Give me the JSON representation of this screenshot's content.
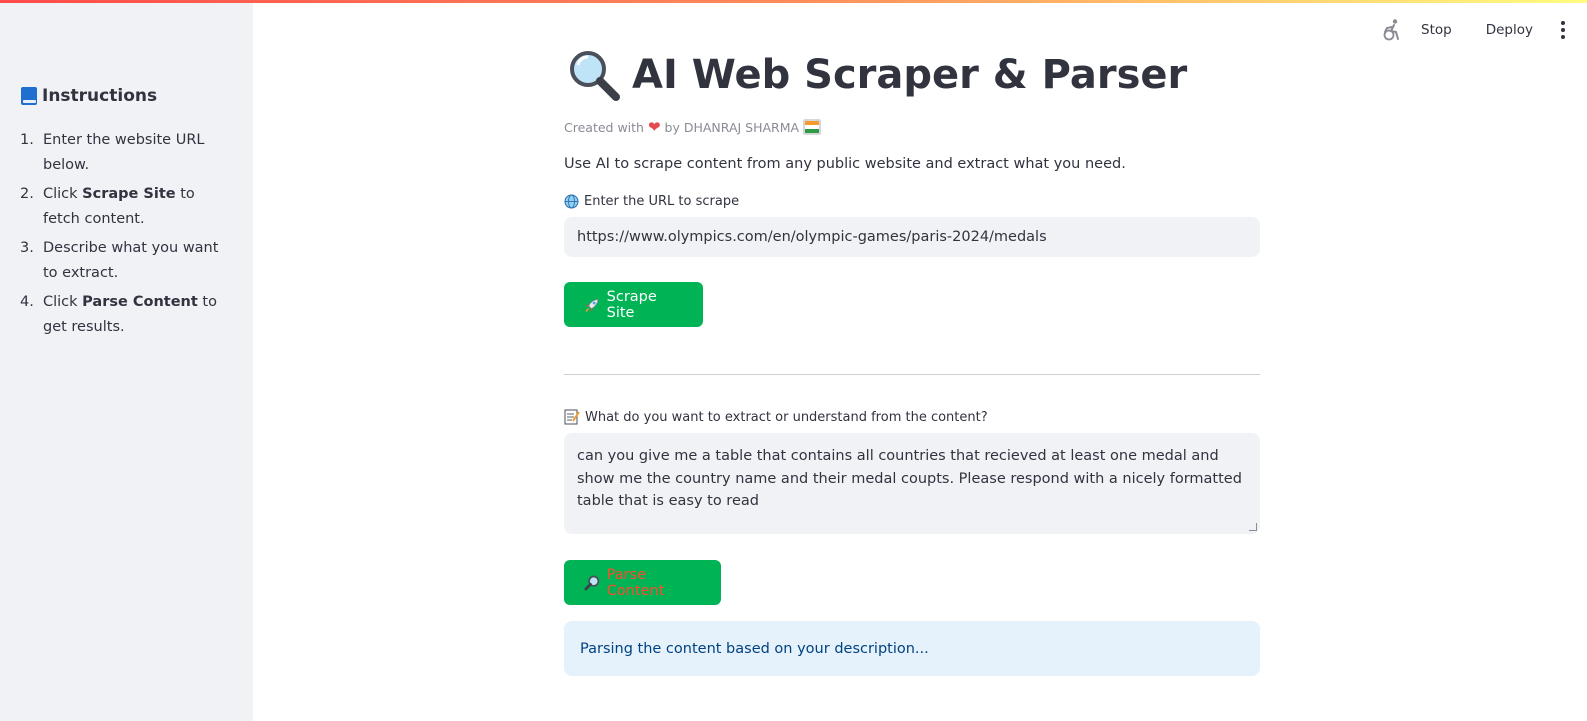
{
  "toolbar": {
    "stop_label": "Stop",
    "deploy_label": "Deploy"
  },
  "sidebar": {
    "header": "Instructions",
    "items": [
      {
        "num": "1.",
        "pre": "Enter the website URL below.",
        "bold": "",
        "post": ""
      },
      {
        "num": "2.",
        "pre": "Click ",
        "bold": "Scrape Site",
        "post": " to fetch content."
      },
      {
        "num": "3.",
        "pre": "Describe what you want to extract.",
        "bold": "",
        "post": ""
      },
      {
        "num": "4.",
        "pre": "Click ",
        "bold": "Parse Content",
        "post": " to get results."
      }
    ]
  },
  "main": {
    "title": "AI Web Scraper & Parser",
    "created_prefix": "Created with",
    "created_suffix": "by DHANRAJ SHARMA",
    "description": "Use AI to scrape content from any public website and extract what you need.",
    "url_label": "Enter the URL to scrape",
    "url_value": "https://www.olympics.com/en/olympic-games/paris-2024/medals",
    "scrape_button": "Scrape Site",
    "extract_label": "What do you want to extract or understand from the content?",
    "extract_value": "can you give me a table that contains all countries that recieved at least one medal and show me the country name and their medal coupts. Please respond with a nicely formatted table that is easy to read",
    "parse_button": "Parse Content",
    "info_text": "Parsing the content based on your description..."
  },
  "colors": {
    "accent_green": "#00b355",
    "sidebar_bg": "#f0f2f6",
    "info_bg": "#e5f1fb",
    "parse_text": "#ff4b2b"
  }
}
